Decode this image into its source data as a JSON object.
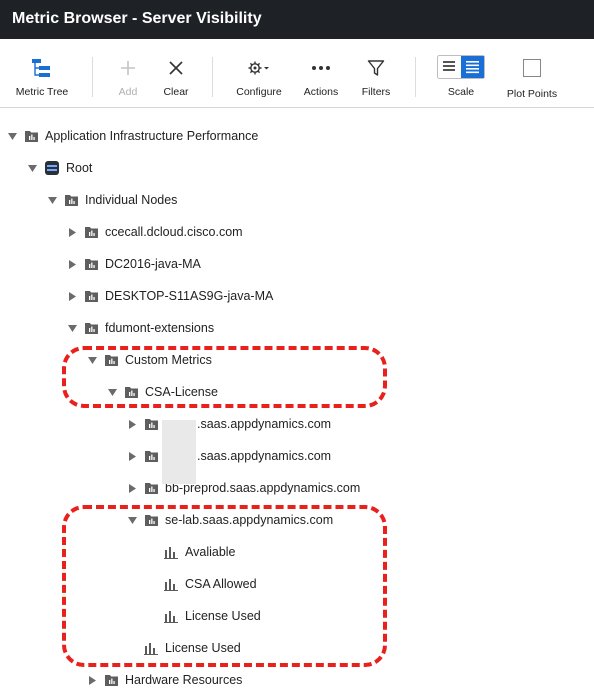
{
  "window": {
    "title": "Metric Browser - Server Visibility"
  },
  "toolbar": {
    "metric_tree": "Metric Tree",
    "add": "Add",
    "clear": "Clear",
    "configure": "Configure",
    "actions": "Actions",
    "filters": "Filters",
    "scale": "Scale",
    "plot_points": "Plot Points"
  },
  "tree": {
    "app_infra": "Application Infrastructure Performance",
    "root": "Root",
    "individual_nodes": "Individual Nodes",
    "node1": "ccecall.dcloud.cisco.com",
    "node2": "DC2016-java-MA",
    "node3": "DESKTOP-S11AS9G-java-MA",
    "node4": "fdumont-extensions",
    "custom_metrics": "Custom Metrics",
    "csa_license": "CSA-License",
    "saas1": ".saas.appdynamics.com",
    "saas2": ".saas.appdynamics.com",
    "saas3": "bb-preprod.saas.appdynamics.com",
    "se_lab": "se-lab.saas.appdynamics.com",
    "avaliable": "Avaliable",
    "csa_allowed": "CSA Allowed",
    "license_used_inner": "License Used",
    "license_used_outer": "License Used",
    "hardware": "Hardware Resources"
  },
  "colors": {
    "titlebar": "#1e2125",
    "accent_blue": "#1a6fd6",
    "highlight_red": "#e8211d"
  }
}
